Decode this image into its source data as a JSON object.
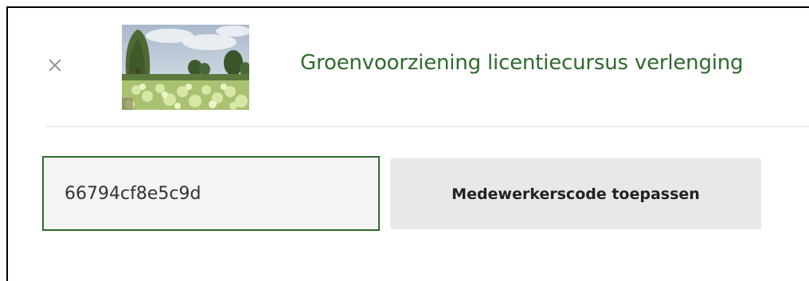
{
  "cart_item": {
    "remove_icon": "close-icon",
    "image_alt": "Tuin met witte hortensia's en treurwilg",
    "title": "Groenvoorziening licentiecursus verlenging"
  },
  "coupon": {
    "value": "66794cf8e5c9d",
    "apply_label": "Medewerkerscode toepassen"
  },
  "colors": {
    "accent_green": "#2d6a2d",
    "button_bg": "#e8e8e8",
    "input_bg": "#f4f4f4"
  }
}
